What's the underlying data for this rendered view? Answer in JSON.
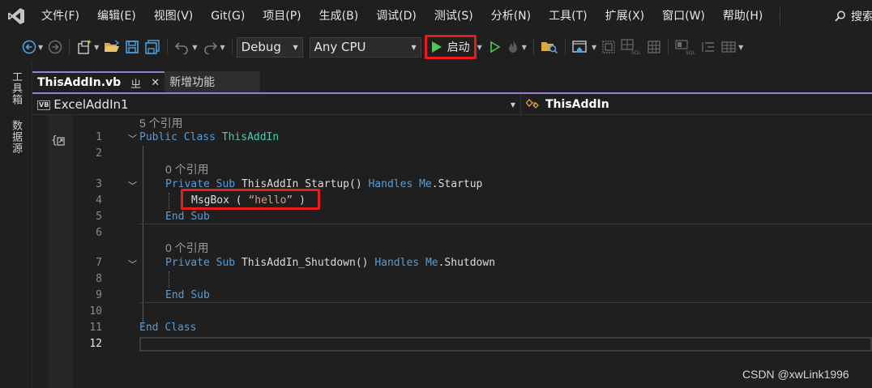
{
  "menubar": {
    "items": [
      "文件(F)",
      "编辑(E)",
      "视图(V)",
      "Git(G)",
      "项目(P)",
      "生成(B)",
      "调试(D)",
      "测试(S)",
      "分析(N)",
      "工具(T)",
      "扩展(X)",
      "窗口(W)",
      "帮助(H)"
    ],
    "search_label": "搜索",
    "logo_icon": "visual-studio-logo-icon"
  },
  "toolbar": {
    "configuration": "Debug",
    "platform": "Any CPU",
    "start_label": "启动",
    "start_color": "#4ec94e",
    "highlight_color": "#e81c1c"
  },
  "left_strip": {
    "toolbox": "工具箱",
    "datasource": "数据源"
  },
  "tabs": [
    {
      "label": "ThisAddIn.vb",
      "pin": "ㄓ",
      "close": "✕",
      "active": true
    },
    {
      "label": "新增功能",
      "active": false
    }
  ],
  "navbar": {
    "badge": "VB",
    "project": "ExcelAddIn1",
    "member": "ThisAddIn"
  },
  "editor": {
    "line_numbers": [
      "1",
      "2",
      "3",
      "4",
      "5",
      "6",
      "7",
      "8",
      "9",
      "10",
      "11",
      "12"
    ],
    "codelens": [
      "5 个引用",
      "0 个引用",
      "0 个引用"
    ],
    "code": {
      "l1_kw1": "Public",
      "l1_kw2": "Class",
      "l1_type": "ThisAddIn",
      "l3_kw1": "Private",
      "l3_kw2": "Sub",
      "l3_name": "ThisAddIn_Startup()",
      "l3_kw3": "Handles",
      "l3_kw4": "Me",
      "l3_event": ".Startup",
      "l4_call": "MsgBox",
      "l4_open": " ( ",
      "l4_str": "“hello”",
      "l4_close": " )",
      "l5_kw1": "End",
      "l5_kw2": "Sub",
      "l7_kw1": "Private",
      "l7_kw2": "Sub",
      "l7_name": "ThisAddIn_Shutdown()",
      "l7_kw3": "Handles",
      "l7_kw4": "Me",
      "l7_event": ".Shutdown",
      "l9_kw1": "End",
      "l9_kw2": "Sub",
      "l11_kw1": "End",
      "l11_kw2": "Class"
    },
    "colors": {
      "keyword": "#569cd6",
      "type": "#4ec9b0",
      "string": "#d69d85",
      "text": "#dcdcdc"
    }
  },
  "watermark": "CSDN @xwLink1996"
}
